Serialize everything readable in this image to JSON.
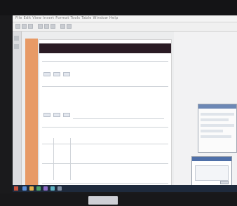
{
  "menubar": {
    "text": "File  Edit  View  Insert  Format  Tools  Table  Window  Help"
  },
  "toolbar": {
    "labels": [
      "",
      ""
    ]
  },
  "document": {
    "header_title": "",
    "rows": [
      {
        "label": ""
      },
      {
        "label": ""
      }
    ]
  },
  "dialog": {
    "title": ""
  },
  "popup": {
    "title": "",
    "button": ""
  },
  "taskbar": {
    "tray": ""
  },
  "colors": {
    "accent_orange": "#e79a66",
    "header_dark": "#2a1b24",
    "taskbar": "#1e2a3c"
  }
}
